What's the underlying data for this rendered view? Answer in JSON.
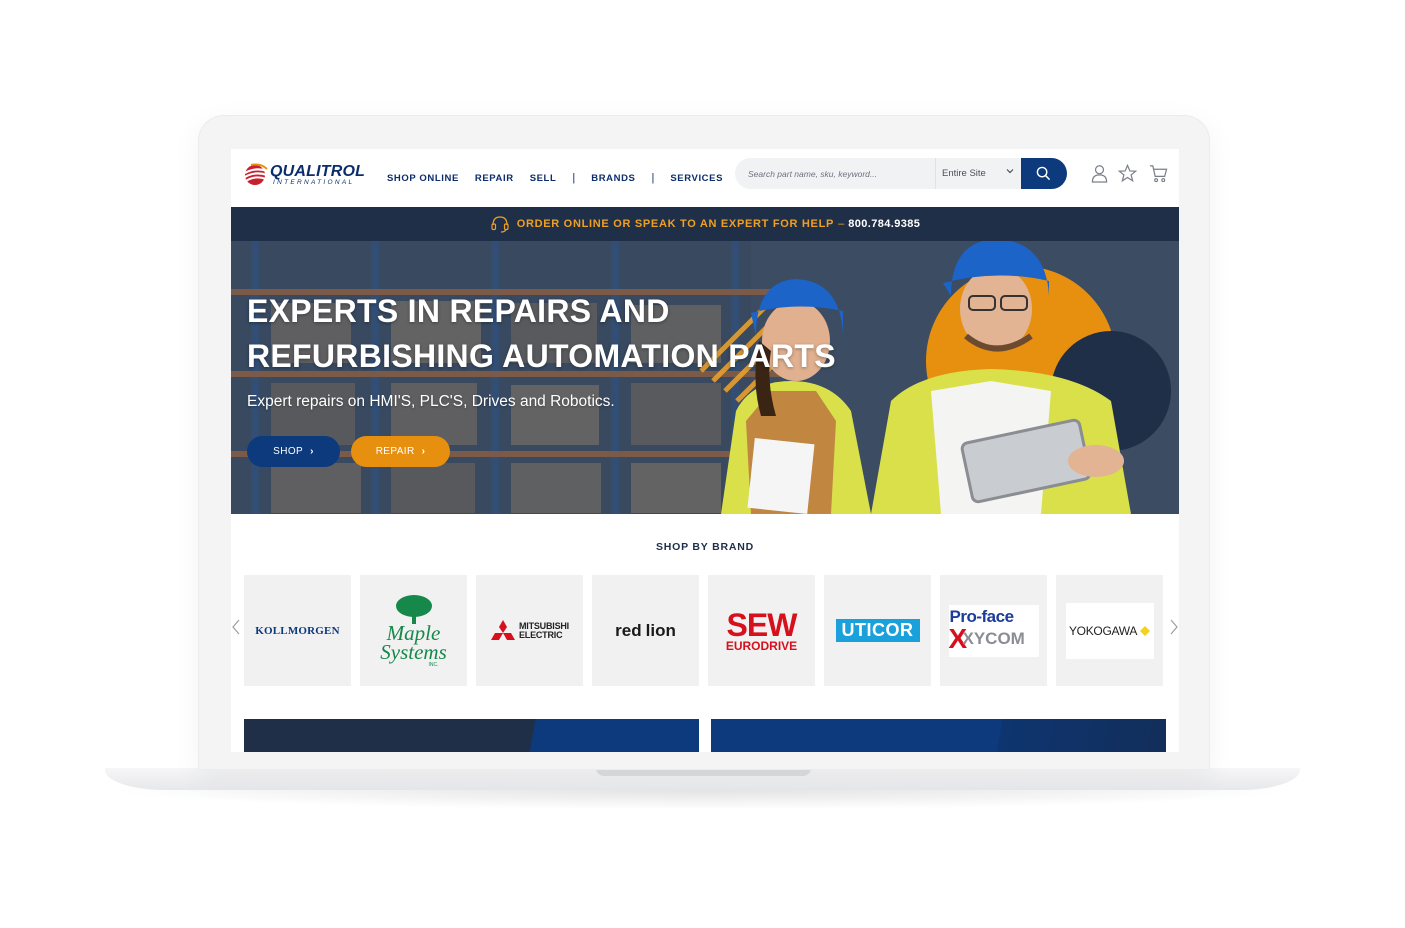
{
  "brand": {
    "name": "QUALITROL",
    "sub": "INTERNATIONAL"
  },
  "nav": {
    "items": [
      "SHOP ONLINE",
      "REPAIR",
      "SELL",
      "BRANDS",
      "SERVICES"
    ],
    "separator": "|"
  },
  "search": {
    "placeholder": "Search part name, sku, keyword...",
    "scope": "Entire Site"
  },
  "announce": {
    "message": "ORDER ONLINE OR SPEAK TO AN EXPERT FOR HELP",
    "dash": "–",
    "phone": "800.784.9385"
  },
  "hero": {
    "title_line1": "EXPERTS IN REPAIRS AND",
    "title_line2": "REFURBISHING AUTOMATION PARTS",
    "subtitle": "Expert repairs on HMI'S, PLC'S, Drives and Robotics.",
    "shop_label": "SHOP",
    "repair_label": "REPAIR"
  },
  "brands": {
    "title": "SHOP BY BRAND",
    "items": [
      {
        "name": "KOLLMORGEN"
      },
      {
        "name": "Maple Systems",
        "line1": "Maple",
        "line2": "Systems",
        "tag": "INC."
      },
      {
        "name": "MITSUBISHI ELECTRIC",
        "line1": "MITSUBISHI",
        "line2": "ELECTRIC"
      },
      {
        "name": "red lion",
        "line1": "red",
        "line2": "lion"
      },
      {
        "name": "SEW EURODRIVE",
        "line1": "SEW",
        "line2": "EURODRIVE"
      },
      {
        "name": "UTICOR"
      },
      {
        "name": "Pro-face XYCOM",
        "line1": "Pro-face",
        "line2": "XYCOM"
      },
      {
        "name": "YOKOGAWA"
      }
    ]
  },
  "colors": {
    "navy": "#0c2d6b",
    "dark_bar": "#1f2f48",
    "orange": "#e7900f",
    "blue_button": "#0c3a7d"
  },
  "icons": [
    "headset-icon",
    "search-icon",
    "user-icon",
    "star-icon",
    "cart-icon",
    "chevron-left-icon",
    "chevron-right-icon"
  ]
}
